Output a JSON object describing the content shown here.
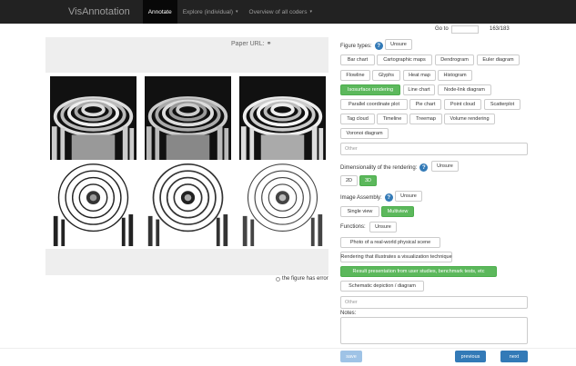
{
  "navbar": {
    "brand": "VisAnnotation",
    "items": [
      {
        "label": "Annotate",
        "active": true
      },
      {
        "label": "Explore (individual)",
        "caret": "▾"
      },
      {
        "label": "Overview of all coders",
        "caret": "▾"
      }
    ]
  },
  "goto": {
    "label": "Go to",
    "value": "",
    "count": "163/183"
  },
  "figure": {
    "paper_url_label": "Paper URL:",
    "link_icon": "link-icon",
    "error_label": "the figure has error"
  },
  "figure_types": {
    "label": "Figure types:",
    "unsure": "Unsure",
    "options": [
      {
        "label": "Bar chart",
        "selected": false
      },
      {
        "label": "Cartographic maps",
        "selected": false
      },
      {
        "label": "Dendrogram",
        "selected": false
      },
      {
        "label": "Euler diagram",
        "selected": false
      },
      {
        "label": "Flowline",
        "selected": false
      },
      {
        "label": "Glyphs",
        "selected": false
      },
      {
        "label": "Heat map",
        "selected": false
      },
      {
        "label": "Histogram",
        "selected": false
      },
      {
        "label": "Isosurface rendering",
        "selected": true
      },
      {
        "label": "Line chart",
        "selected": false
      },
      {
        "label": "Node-link diagram",
        "selected": false
      },
      {
        "label": "Parallel coordinate plot",
        "selected": false
      },
      {
        "label": "Pie chart",
        "selected": false
      },
      {
        "label": "Point cloud",
        "selected": false
      },
      {
        "label": "Scatterplot",
        "selected": false
      },
      {
        "label": "Tag cloud",
        "selected": false
      },
      {
        "label": "Timeline",
        "selected": false
      },
      {
        "label": "Treemap",
        "selected": false
      },
      {
        "label": "Volume rendering",
        "selected": false
      },
      {
        "label": "Voronoi diagram",
        "selected": false
      }
    ],
    "other_placeholder": "Other"
  },
  "dimensionality": {
    "label": "Dimensionality of the rendering:",
    "unsure": "Unsure",
    "options": [
      {
        "label": "2D",
        "selected": false
      },
      {
        "label": "3D",
        "selected": true
      }
    ]
  },
  "assembly": {
    "label": "Image Assembly:",
    "unsure": "Unsure",
    "options": [
      {
        "label": "Single view",
        "selected": false
      },
      {
        "label": "Multiview",
        "selected": true
      }
    ]
  },
  "functions": {
    "label": "Functions:",
    "unsure": "Unsure",
    "options": [
      {
        "label": "Photo of a real-world physical scene",
        "selected": false
      },
      {
        "label": "Rendering that illustrates a visualization technique",
        "selected": false
      },
      {
        "label": "Result presentation from user studies, benchmark tests, etc",
        "selected": true
      },
      {
        "label": "Schematic depiction / diagram",
        "selected": false
      }
    ],
    "other_placeholder": "Other"
  },
  "notes": {
    "label": "Notes:",
    "value": ""
  },
  "actions": {
    "save": "save",
    "previous": "previous",
    "next": "next"
  },
  "colors": {
    "selected": "#5cb85c",
    "primary": "#337ab7",
    "help": "#337ab7",
    "navbar": "#222222"
  }
}
